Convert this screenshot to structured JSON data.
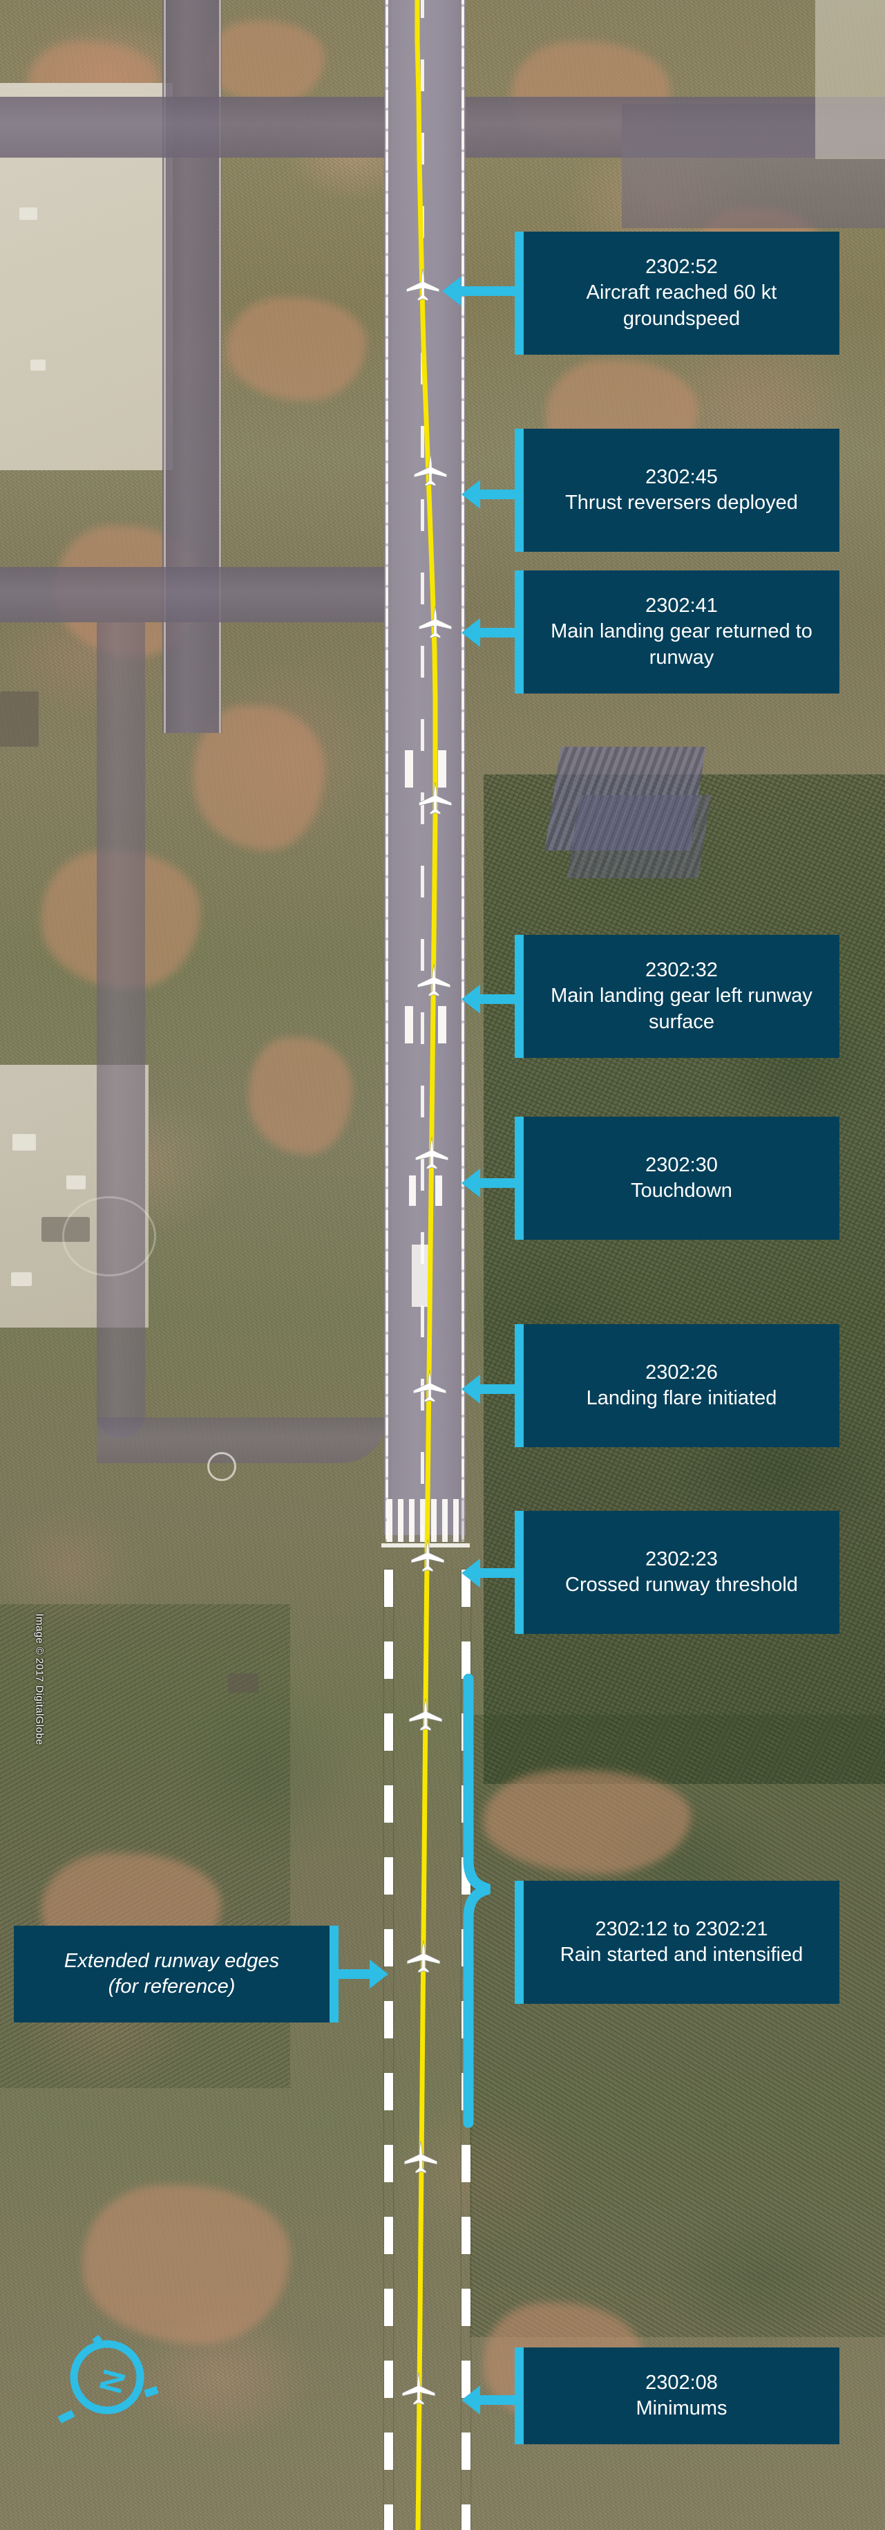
{
  "figure": {
    "type": "annotated-satellite-diagram",
    "subject": "Aircraft landing sequence annotated on airport runway satellite imagery",
    "attribution": "Image © 2017 DigitalGlobe",
    "compass_label": "N"
  },
  "colors": {
    "callout_background": "#05405a",
    "accent_cyan": "#2ebde5",
    "track_yellow": "#f7e600",
    "callout_text": "#ffffff",
    "extended_edge_white": "#ffffff"
  },
  "callouts": [
    {
      "id": "gs60",
      "time": "2302:52",
      "text": "Aircraft reached 60 kt groundspeed",
      "side": "right"
    },
    {
      "id": "reversers",
      "time": "2302:45",
      "text": "Thrust reversers deployed",
      "side": "right"
    },
    {
      "id": "gear-return",
      "time": "2302:41",
      "text": "Main landing gear returned to runway",
      "side": "right"
    },
    {
      "id": "gear-left",
      "time": "2302:32",
      "text": "Main landing gear left runway surface",
      "side": "right"
    },
    {
      "id": "touchdown",
      "time": "2302:30",
      "text": "Touchdown",
      "side": "right"
    },
    {
      "id": "flare",
      "time": "2302:26",
      "text": "Landing flare initiated",
      "side": "right"
    },
    {
      "id": "threshold",
      "time": "2302:23",
      "text": "Crossed runway threshold",
      "side": "right"
    },
    {
      "id": "rain",
      "time": "2302:12 to 2302:21",
      "text": "Rain started and intensified",
      "side": "right"
    },
    {
      "id": "minimums",
      "time": "2302:08",
      "text": "Minimums",
      "side": "right"
    }
  ],
  "reference_label": {
    "line1": "Extended runway edges",
    "line2": "(for reference)",
    "side": "left"
  }
}
